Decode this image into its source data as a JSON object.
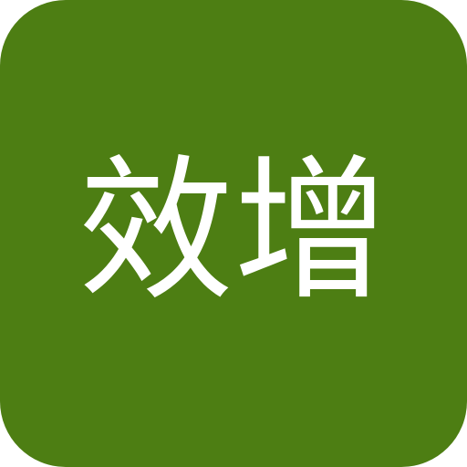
{
  "app_icon": {
    "label": "效增",
    "background_color": "#4d7e13",
    "text_color": "#ffffff"
  }
}
